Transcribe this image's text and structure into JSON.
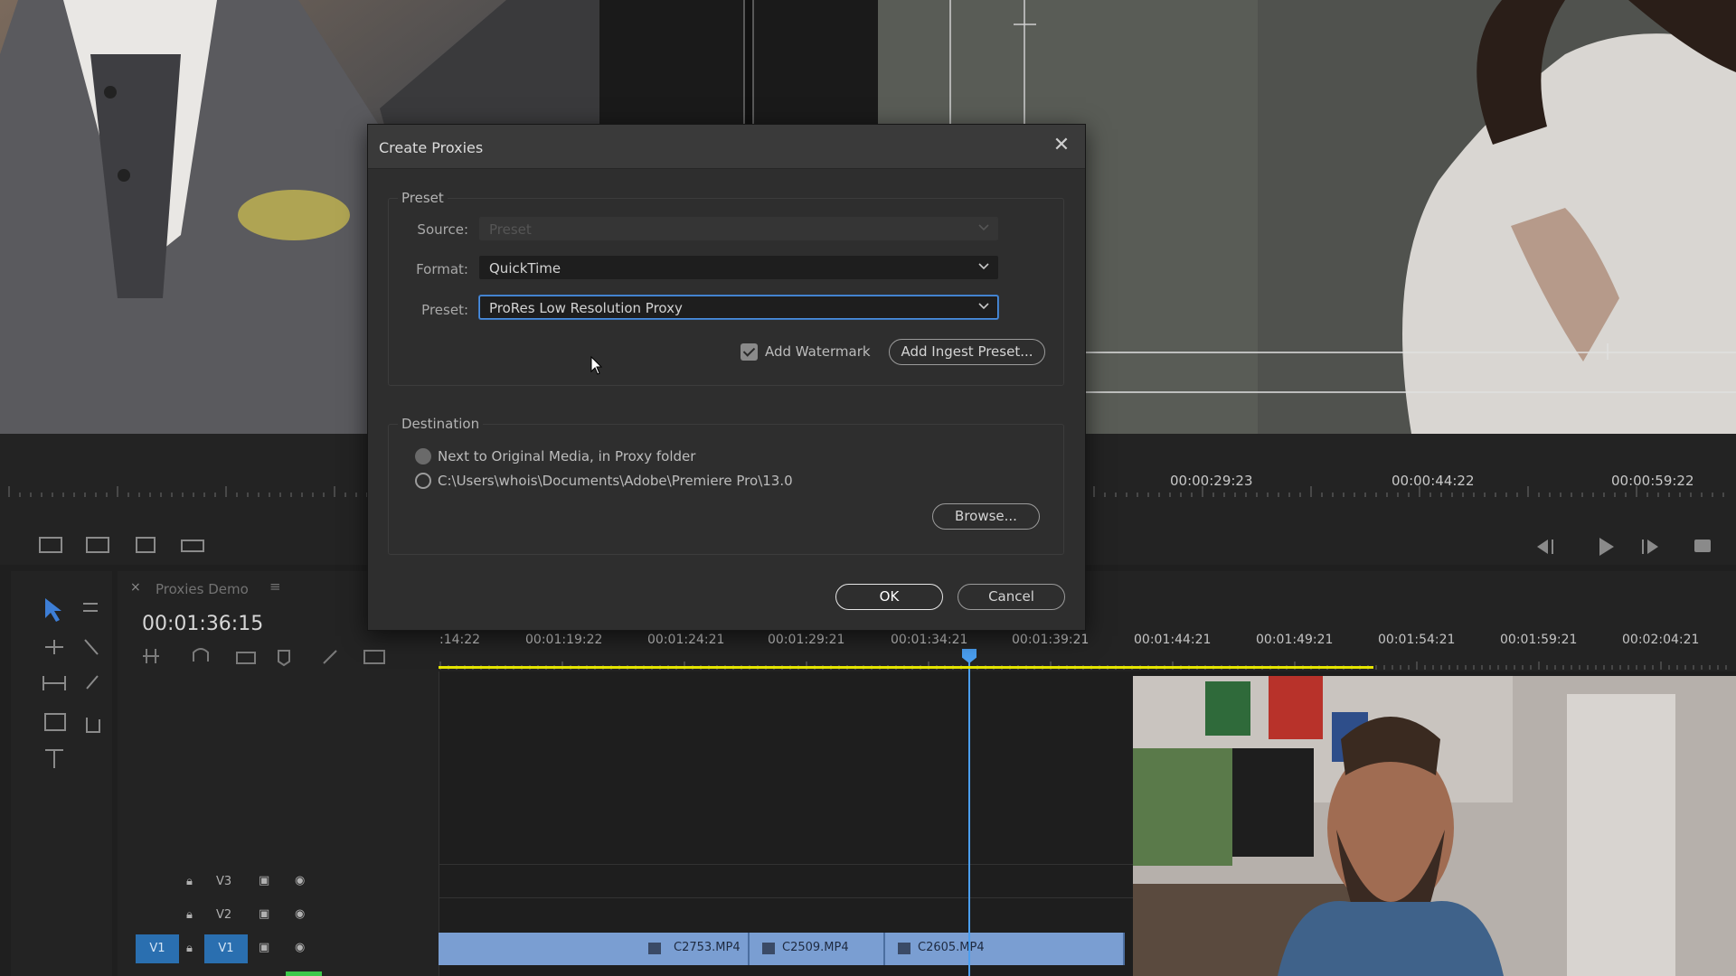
{
  "dialog": {
    "title": "Create Proxies",
    "close_icon": "close-icon",
    "preset_group": {
      "legend": "Preset",
      "source_label": "Source:",
      "source_value": "Preset",
      "format_label": "Format:",
      "format_value": "QuickTime",
      "preset_label": "Preset:",
      "preset_value": "ProRes Low Resolution Proxy",
      "watermark_label": "Add Watermark",
      "watermark_checked": true,
      "ingest_button": "Add Ingest Preset..."
    },
    "destination_group": {
      "legend": "Destination",
      "option_1": "Next to Original Media, in Proxy folder",
      "option_2": "C:\\Users\\whois\\Documents\\Adobe\\Premiere Pro\\13.0",
      "browse_button": "Browse..."
    },
    "ok_button": "OK",
    "cancel_button": "Cancel"
  },
  "program_ruler": {
    "timecodes": [
      "00:00:29:23",
      "00:00:44:22",
      "00:00:59:22"
    ]
  },
  "timeline": {
    "sequence_name": "Proxies Demo",
    "playhead_timecode": "00:01:36:15",
    "ruler_timecodes": [
      ":14:22",
      "00:01:19:22",
      "00:01:24:21",
      "00:01:29:21",
      "00:01:34:21",
      "00:01:39:21",
      "00:01:44:21",
      "00:01:49:21",
      "00:01:54:21",
      "00:01:59:21",
      "00:02:04:21"
    ],
    "tracks": [
      {
        "label": "V3"
      },
      {
        "label": "V2"
      },
      {
        "label": "V1",
        "source": "V1"
      }
    ],
    "clips": [
      "C2753.MP4",
      "C2509.MP4",
      "C2605.MP4"
    ]
  },
  "colors": {
    "accent": "#4b8fe0",
    "clip": "#7a9ed2",
    "work_area": "#e4e400",
    "track_target": "#2a6fb0"
  }
}
